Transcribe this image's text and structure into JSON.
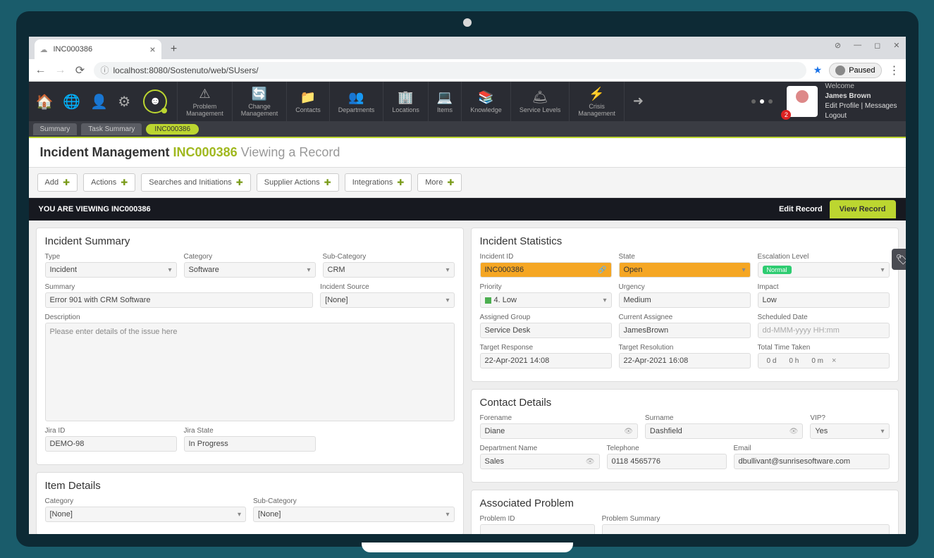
{
  "browser": {
    "tab_title": "INC000386",
    "url_display": "localhost:8080/Sostenuto/web/SUsers/",
    "paused": "Paused"
  },
  "win": {
    "restore": "◻",
    "minimize": "—",
    "stop": "⊘",
    "close": "✕"
  },
  "header": {
    "modules": [
      {
        "icon": "⚠",
        "label1": "Problem",
        "label2": "Management"
      },
      {
        "icon": "🔄",
        "label1": "Change",
        "label2": "Management"
      },
      {
        "icon": "📁",
        "label1": "Contacts",
        "label2": ""
      },
      {
        "icon": "👥",
        "label1": "Departments",
        "label2": ""
      },
      {
        "icon": "🏢",
        "label1": "Locations",
        "label2": ""
      },
      {
        "icon": "💻",
        "label1": "Items",
        "label2": ""
      },
      {
        "icon": "📚",
        "label1": "Knowledge",
        "label2": ""
      },
      {
        "icon": "🛎",
        "label1": "Service Levels",
        "label2": ""
      },
      {
        "icon": "⚡",
        "label1": "Crisis",
        "label2": "Management"
      },
      {
        "icon": "➜",
        "label1": "",
        "label2": ""
      }
    ],
    "welcome_label": "Welcome",
    "user_name": "James Brown",
    "edit_profile": "Edit Profile",
    "messages": "Messages",
    "logout": "Logout",
    "badge": "2"
  },
  "sec_tabs": {
    "summary": "Summary",
    "task_summary": "Task Summary",
    "active": "INC000386"
  },
  "page_title": {
    "main": "Incident Management",
    "id": "INC000386",
    "sub": "Viewing a Record"
  },
  "actions": [
    "Add",
    "Actions",
    "Searches and Initiations",
    "Supplier Actions",
    "Integrations",
    "More"
  ],
  "banner": {
    "viewing": "YOU ARE VIEWING INC000386",
    "edit": "Edit Record",
    "view": "View Record"
  },
  "incident_summary": {
    "title": "Incident Summary",
    "type_label": "Type",
    "type": "Incident",
    "category_label": "Category",
    "category": "Software",
    "subcategory_label": "Sub-Category",
    "subcategory": "CRM",
    "summary_label": "Summary",
    "summary": "Error 901 with CRM Software",
    "source_label": "Incident Source",
    "source": "[None]",
    "description_label": "Description",
    "description_placeholder": "Please enter details of the issue here",
    "jira_id_label": "Jira ID",
    "jira_id": "DEMO-98",
    "jira_state_label": "Jira State",
    "jira_state": "In Progress"
  },
  "stats": {
    "title": "Incident Statistics",
    "id_label": "Incident ID",
    "id": "INC000386",
    "state_label": "State",
    "state": "Open",
    "escalation_label": "Escalation Level",
    "escalation": "Normal",
    "priority_label": "Priority",
    "priority": "4. Low",
    "urgency_label": "Urgency",
    "urgency": "Medium",
    "impact_label": "Impact",
    "impact": "Low",
    "group_label": "Assigned Group",
    "group": "Service Desk",
    "assignee_label": "Current Assignee",
    "assignee": "JamesBrown",
    "scheduled_label": "Scheduled Date",
    "scheduled_placeholder": "dd-MMM-yyyy HH:mm",
    "target_resp_label": "Target Response",
    "target_resp": "22-Apr-2021 14:08",
    "target_res_label": "Target Resolution",
    "target_res": "22-Apr-2021 16:08",
    "total_time_label": "Total Time Taken",
    "d": "0 d",
    "h": "0 h",
    "m": "0 m"
  },
  "contact": {
    "title": "Contact Details",
    "forename_label": "Forename",
    "forename": "Diane",
    "surname_label": "Surname",
    "surname": "Dashfield",
    "vip_label": "VIP?",
    "vip": "Yes",
    "dept_label": "Department Name",
    "dept": "Sales",
    "tel_label": "Telephone",
    "tel": "0118 4565776",
    "email_label": "Email",
    "email": "dbullivant@sunrisesoftware.com"
  },
  "item_details": {
    "title": "Item Details",
    "category_label": "Category",
    "category": "[None]",
    "subcategory_label": "Sub-Category",
    "subcategory": "[None]"
  },
  "assoc_problem": {
    "title": "Associated Problem",
    "pid_label": "Problem ID",
    "psummary_label": "Problem Summary"
  }
}
